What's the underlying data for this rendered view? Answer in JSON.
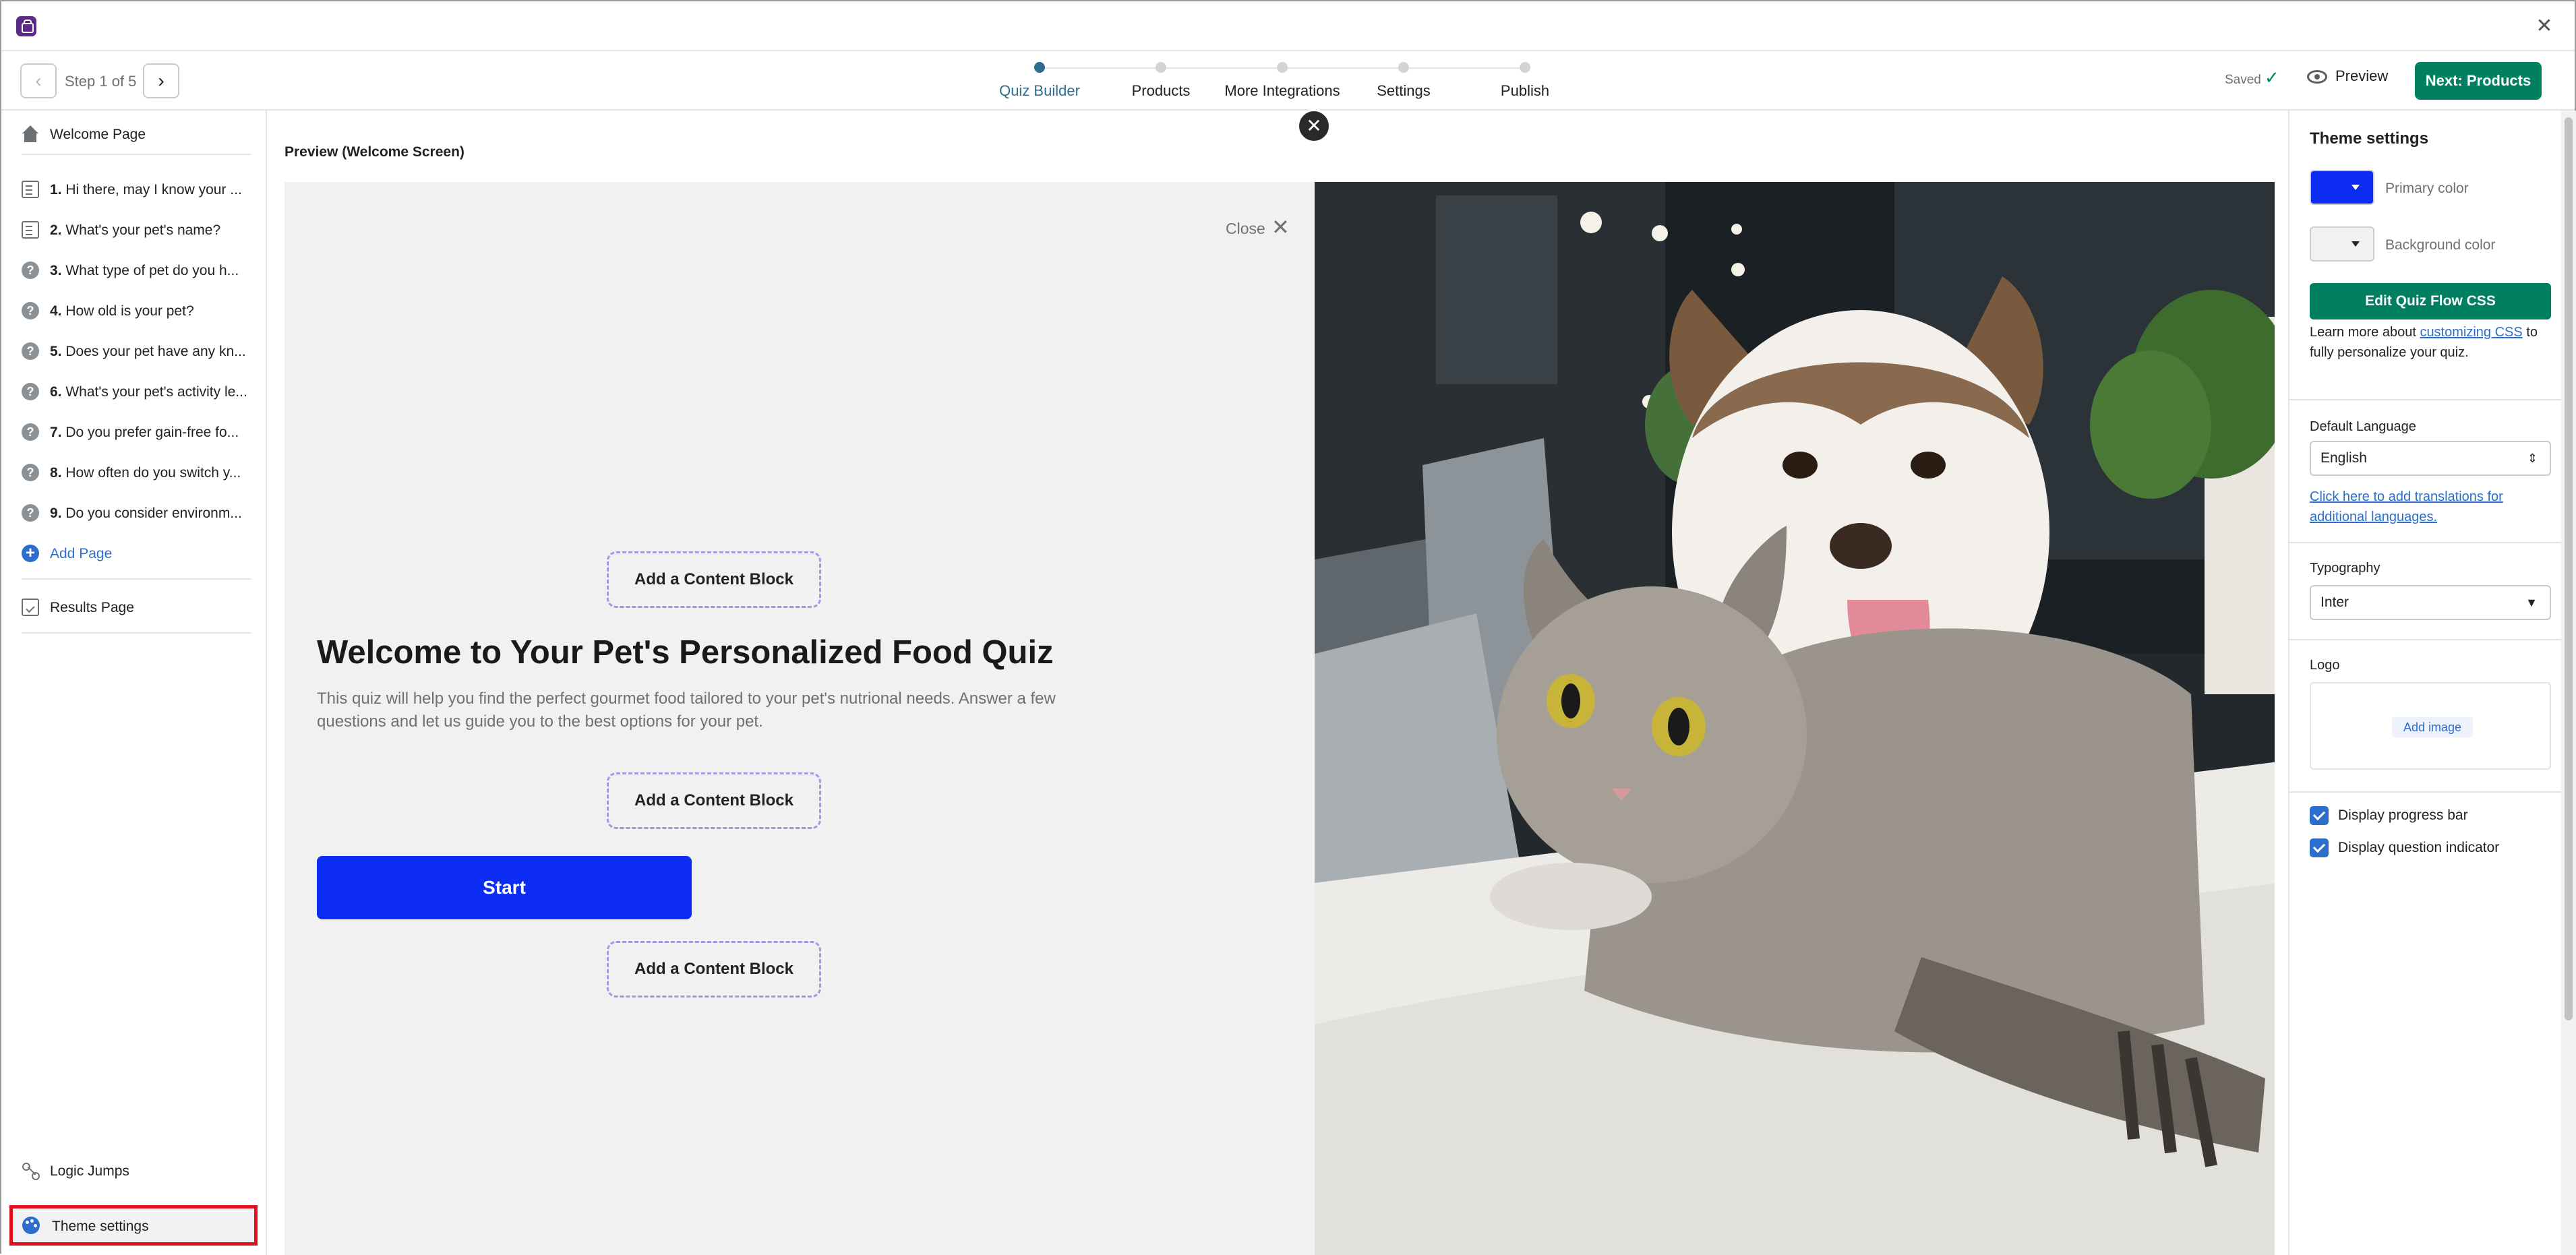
{
  "header": {
    "step_label": "Step 1 of 5",
    "steps": [
      "Quiz Builder",
      "Products",
      "More Integrations",
      "Settings",
      "Publish"
    ],
    "active_step": "Quiz Builder",
    "saved_label": "Saved",
    "preview_label": "Preview",
    "next_label": "Next: Products"
  },
  "sidebar": {
    "welcome": "Welcome Page",
    "questions": [
      {
        "num": "1.",
        "text": "Hi there, may I know your ..."
      },
      {
        "num": "2.",
        "text": "What's your pet's name?"
      },
      {
        "num": "3.",
        "text": "What type of pet do you h..."
      },
      {
        "num": "4.",
        "text": "How old is your pet?"
      },
      {
        "num": "5.",
        "text": "Does your pet have any kn..."
      },
      {
        "num": "6.",
        "text": "What's your pet's activity le..."
      },
      {
        "num": "7.",
        "text": "Do you prefer gain-free fo..."
      },
      {
        "num": "8.",
        "text": "How often do you switch y..."
      },
      {
        "num": "9.",
        "text": "Do you consider environm..."
      }
    ],
    "add_page": "Add Page",
    "results": "Results Page",
    "logic_jumps": "Logic Jumps",
    "theme_settings": "Theme settings"
  },
  "preview": {
    "title": "Preview (Welcome Screen)",
    "close_label": "Close",
    "content_block_label": "Add a Content Block",
    "welcome_title": "Welcome to Your Pet's Personalized Food Quiz",
    "welcome_desc": "This quiz will help you find the perfect gourmet food tailored to your pet's nutrional needs. Answer a few questions and let us guide you to the best options for your pet.",
    "start_label": "Start"
  },
  "theme": {
    "heading": "Theme settings",
    "primary_color_label": "Primary color",
    "primary_color": "#0d2ef2",
    "background_color_label": "Background color",
    "background_color": "#f1f1f1",
    "edit_css_label": "Edit Quiz Flow CSS",
    "learn_prefix": "Learn more about ",
    "learn_link": "customizing CSS",
    "learn_suffix": " to fully personalize your quiz.",
    "default_language_label": "Default Language",
    "default_language_value": "English",
    "translations_link": "Click here to add translations for additional languages.",
    "typography_label": "Typography",
    "typography_value": "Inter",
    "logo_label": "Logo",
    "add_image_label": "Add image",
    "display_progress_bar": "Display progress bar",
    "display_question_indicator": "Display question indicator"
  },
  "colors": {
    "accent_green": "#008060",
    "highlight_red": "#e0101c",
    "link_blue": "#2c6ecb"
  }
}
